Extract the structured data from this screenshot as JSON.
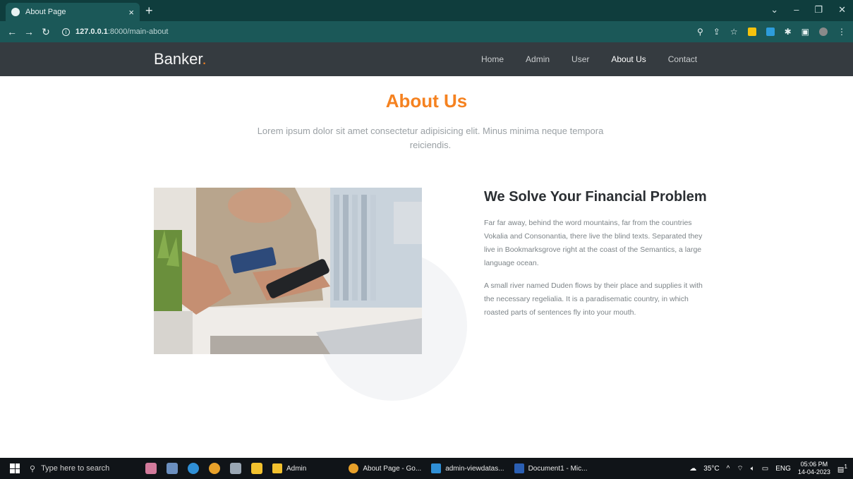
{
  "browser": {
    "tab_title": "About Page",
    "tab_close": "×",
    "new_tab": "+",
    "url_host": "127.0.0.1",
    "url_path": ":8000/main-about",
    "info_icon": "i"
  },
  "site": {
    "brand": "Banker",
    "brand_dot": ".",
    "nav": {
      "home": "Home",
      "admin": "Admin",
      "user": "User",
      "about": "About Us",
      "contact": "Contact"
    }
  },
  "about": {
    "title": "About Us",
    "lead": "Lorem ipsum dolor sit amet consectetur adipisicing elit. Minus minima neque tempora reiciendis."
  },
  "section": {
    "title": "We Solve Your Financial Problem",
    "para1": "Far far away, behind the word mountains, far from the countries Vokalia and Consonantia, there live the blind texts. Separated they live in Bookmarksgrove right at the coast of the Semantics, a large language ocean.",
    "para2": "A small river named Duden flows by their place and supplies it with the necessary regelialia. It is a paradisematic country, in which roasted parts of sentences fly into your mouth."
  },
  "taskbar": {
    "search_placeholder": "Type here to search",
    "apps": {
      "admin": "Admin",
      "chrome": "About Page - Go...",
      "vscode": "admin-viewdatas...",
      "word": "Document1 - Mic..."
    },
    "weather": "35°C",
    "lang": "ENG",
    "time": "05:06 PM",
    "date": "14-04-2023",
    "notification_count": "1"
  },
  "colors": {
    "accent": "#f58220",
    "header_bg": "#353b40",
    "browser_bg": "#1b5858"
  }
}
